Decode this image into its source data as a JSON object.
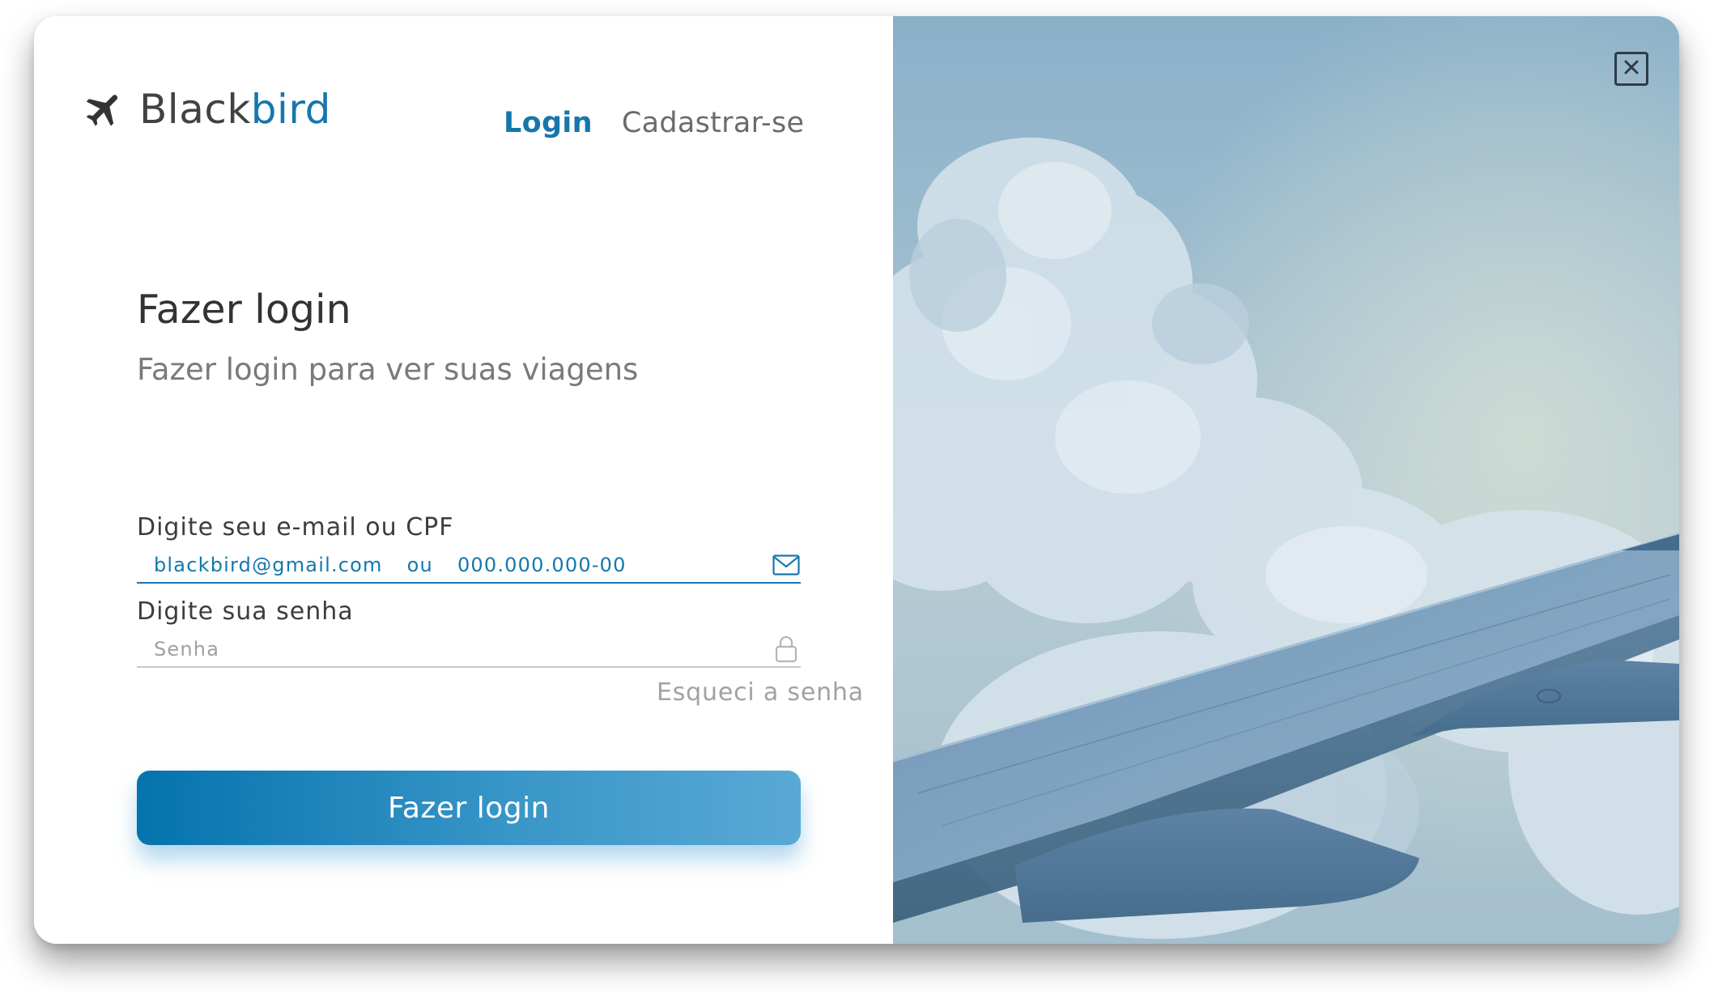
{
  "brand": {
    "name_part1": "Black",
    "name_part2": "bird",
    "icon": "airplane-icon",
    "accent_color": "#1677ad"
  },
  "nav": {
    "login_label": "Login",
    "signup_label": "Cadastrar-se",
    "active": "login"
  },
  "form": {
    "title": "Fazer login",
    "subtitle": "Fazer login para ver suas viagens",
    "email_field": {
      "label": "Digite seu e-mail ou CPF",
      "value_email": "blackbird@gmail.com",
      "value_separator": "ou",
      "value_cpf": "000.000.000-00",
      "icon": "mail-icon"
    },
    "password_field": {
      "label": "Digite sua senha",
      "placeholder": "Senha",
      "icon": "lock-icon"
    },
    "forgot_label": "Esqueci a senha",
    "submit_label": "Fazer login"
  },
  "hero": {
    "image": "airplane-wing-above-clouds",
    "close_icon": "close-icon"
  }
}
